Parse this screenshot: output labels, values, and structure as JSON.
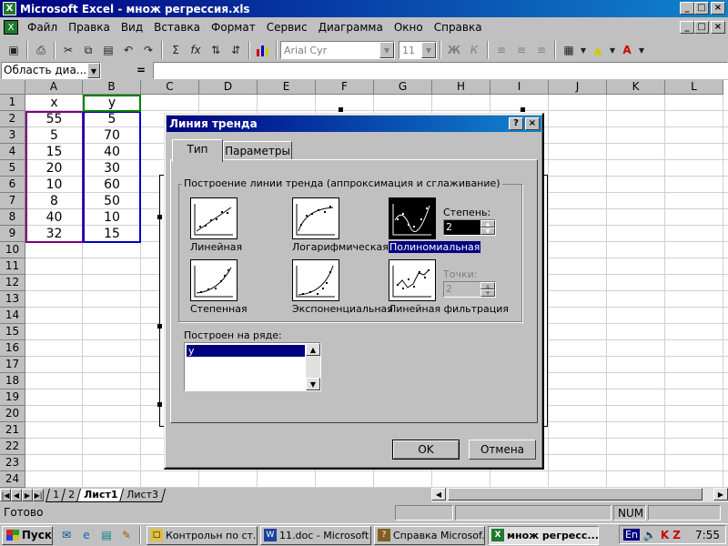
{
  "window": {
    "title": "Microsoft Excel - множ регрессия.xls",
    "min": "_",
    "max": "□",
    "close": "×",
    "doc_min": "_",
    "doc_max": "□",
    "doc_close": "×"
  },
  "menu": [
    "Файл",
    "Правка",
    "Вид",
    "Вставка",
    "Формат",
    "Сервис",
    "Диаграмма",
    "Окно",
    "Справка"
  ],
  "toolbar": {
    "font_name": "Arial Cyr",
    "font_size": "11",
    "bold": "Ж",
    "italic": "К",
    "sigma": "Σ",
    "fx": "fx"
  },
  "formula_bar": {
    "name_box": "Область диа...",
    "equals": "="
  },
  "grid": {
    "columns": [
      "A",
      "B",
      "C",
      "D",
      "E",
      "F",
      "G",
      "H",
      "I",
      "J",
      "K",
      "L"
    ],
    "rows": [
      "1",
      "2",
      "3",
      "4",
      "5",
      "6",
      "7",
      "8",
      "9",
      "10",
      "11",
      "12",
      "13",
      "14",
      "15",
      "16",
      "17",
      "18",
      "19",
      "20",
      "21",
      "22",
      "23",
      "24"
    ],
    "headers": {
      "A1": "x",
      "B1": "y"
    },
    "data": [
      {
        "x": "55",
        "y": "5"
      },
      {
        "x": "5",
        "y": "70"
      },
      {
        "x": "15",
        "y": "40"
      },
      {
        "x": "20",
        "y": "30"
      },
      {
        "x": "10",
        "y": "60"
      },
      {
        "x": "8",
        "y": "50"
      },
      {
        "x": "40",
        "y": "10"
      },
      {
        "x": "32",
        "y": "15"
      }
    ]
  },
  "sheets": {
    "tabs": [
      "1",
      "2",
      "Лист1",
      "Лист3"
    ],
    "active": "Лист1"
  },
  "status": {
    "ready": "Готово",
    "num": "NUM"
  },
  "dialog": {
    "title": "Линия тренда",
    "help": "?",
    "close": "×",
    "tabs": [
      "Тип",
      "Параметры"
    ],
    "active_tab": "Тип",
    "group_title": "Построение линии тренда (аппроксимация и сглаживание)",
    "types": [
      {
        "id": "linear",
        "label": "Линейная"
      },
      {
        "id": "log",
        "label": "Логарифмическая"
      },
      {
        "id": "poly",
        "label": "Полиномиальная",
        "selected": true
      },
      {
        "id": "power",
        "label": "Степенная"
      },
      {
        "id": "exp",
        "label": "Экспоненциальная"
      },
      {
        "id": "ma",
        "label": "Линейная фильтрация"
      }
    ],
    "degree_label": "Степень:",
    "degree_value": "2",
    "points_label": "Точки:",
    "points_value": "2",
    "series_label": "Построен на ряде:",
    "series_items": [
      "y"
    ],
    "ok": "OK",
    "cancel": "Отмена"
  },
  "taskbar": {
    "start": "Пуск",
    "buttons": [
      {
        "label": "Контрольн по ст...",
        "icon": "folder-icon"
      },
      {
        "label": "11.doc - Microsoft ...",
        "icon": "word-icon"
      },
      {
        "label": "Справка Microsof...",
        "icon": "help-icon"
      },
      {
        "label": "множ регресс...",
        "icon": "excel-icon",
        "active": true
      }
    ],
    "lang": "En",
    "clock": "7:55"
  },
  "colors": {
    "title_start": "#000080",
    "title_end": "#1084d0",
    "face": "#c0c0c0",
    "select_border": "#800080",
    "selection": "#000080"
  }
}
